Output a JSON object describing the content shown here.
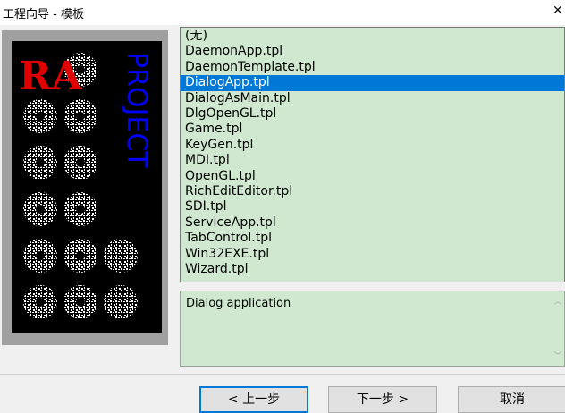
{
  "window": {
    "title": "工程向导 - 模板",
    "close_glyph": "✕"
  },
  "logo": {
    "word": "PROJECT",
    "mark": "RA"
  },
  "template_list": {
    "items": [
      "(无)",
      "DaemonApp.tpl",
      "DaemonTemplate.tpl",
      "DialogApp.tpl",
      "DialogAsMain.tpl",
      "DlgOpenGL.tpl",
      "Game.tpl",
      "KeyGen.tpl",
      "MDI.tpl",
      "OpenGL.tpl",
      "RichEditEditor.tpl",
      "SDI.tpl",
      "ServiceApp.tpl",
      "TabControl.tpl",
      "Win32EXE.tpl",
      "Wizard.tpl"
    ],
    "selected_index": 3
  },
  "description": {
    "text": "Dialog application"
  },
  "buttons": {
    "back": "< 上一步",
    "next": "下一步 >",
    "cancel": "取消"
  },
  "colors": {
    "list_bg": "#cfe8cf",
    "selection": "#0078d7",
    "logo_red": "#e00000",
    "logo_blue": "#0000ff"
  }
}
